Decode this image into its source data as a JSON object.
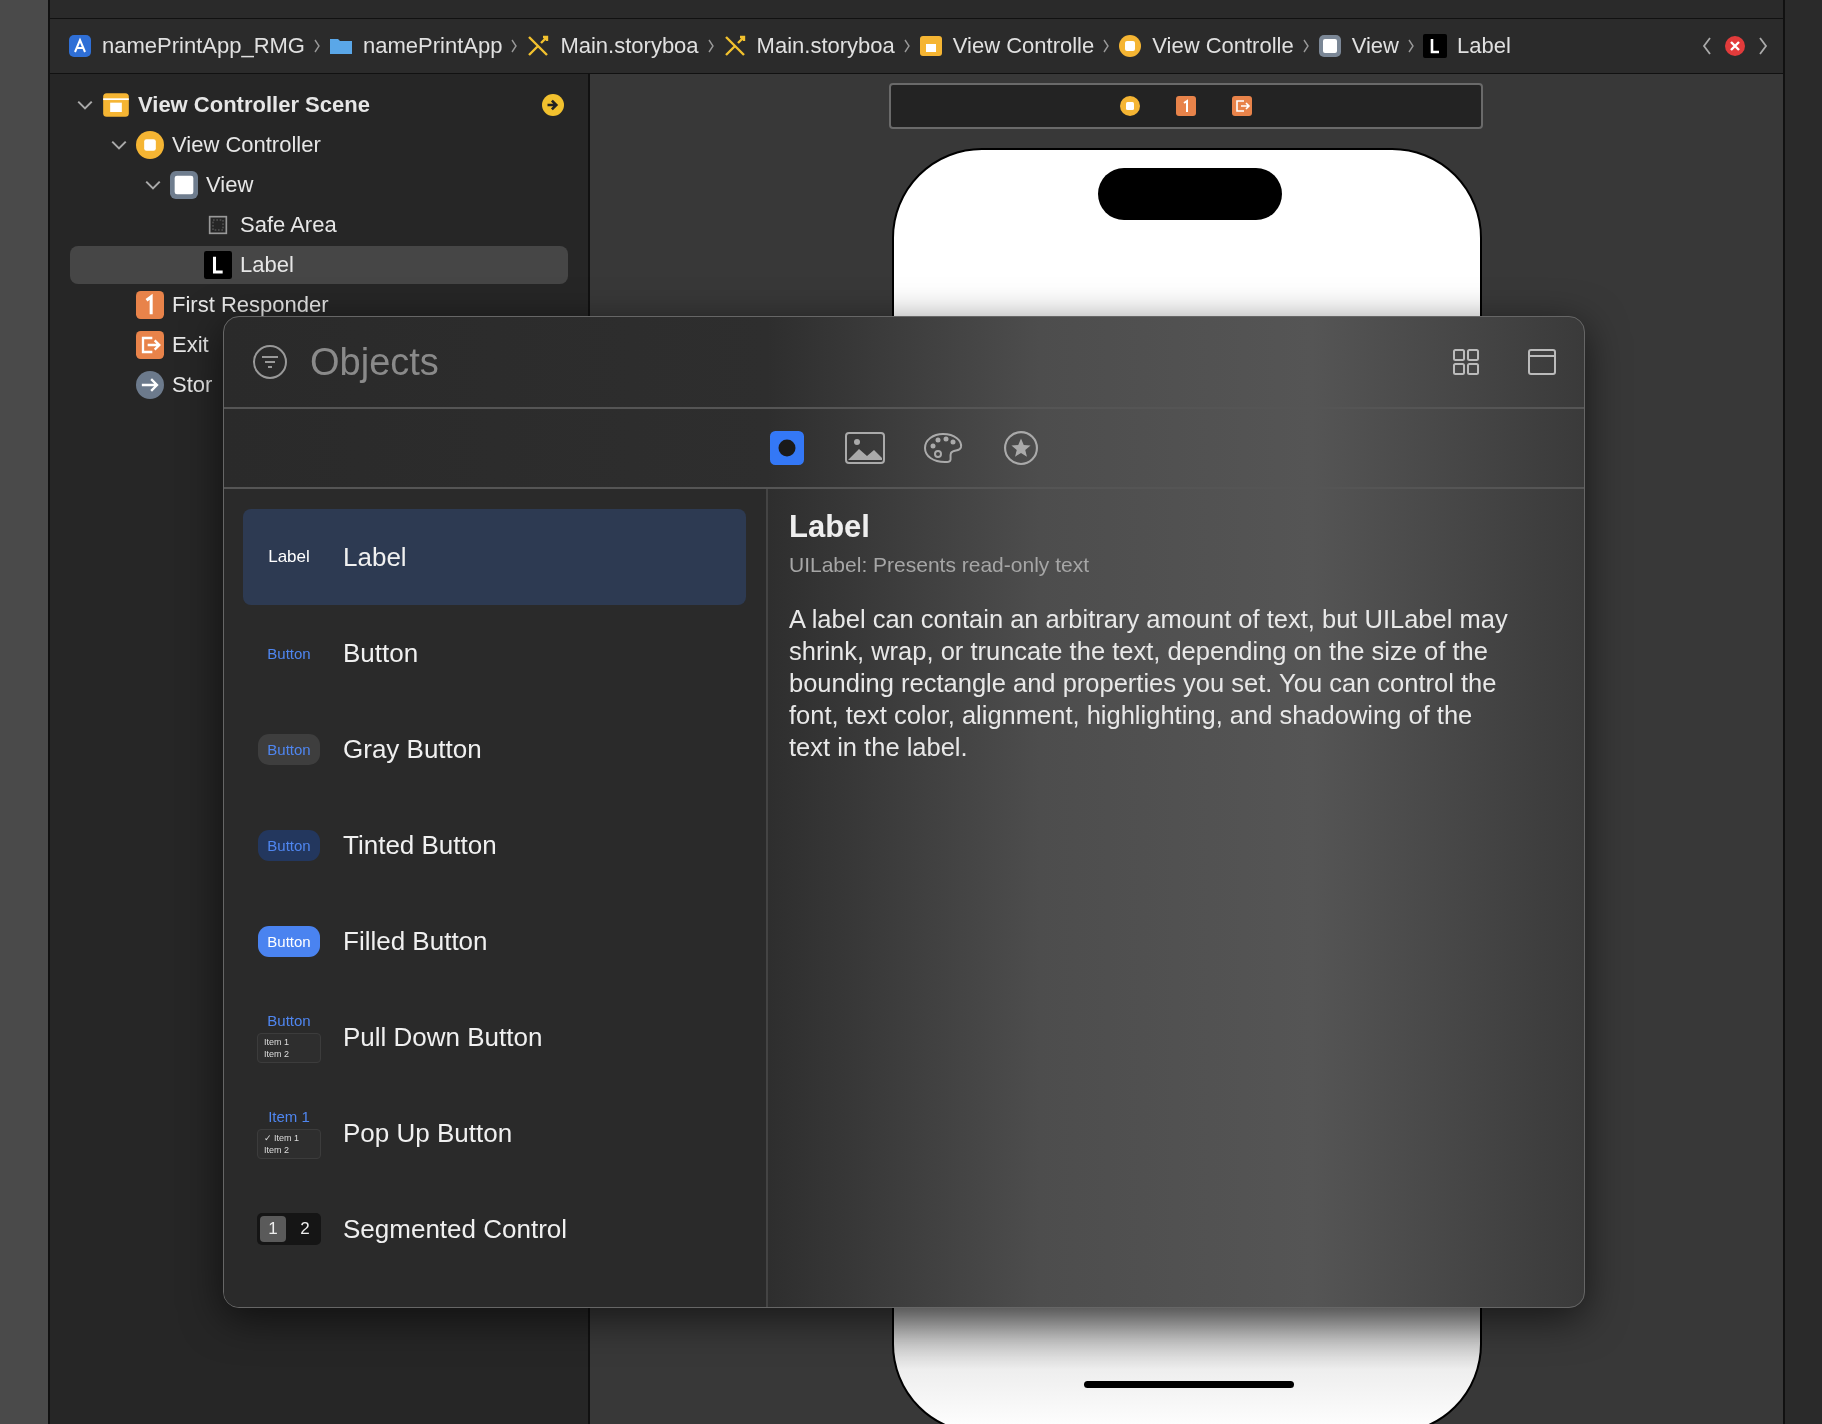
{
  "breadcrumb": [
    {
      "kind": "app",
      "label": "namePrintApp_RMG"
    },
    {
      "kind": "folder",
      "label": "namePrintApp"
    },
    {
      "kind": "storyboard",
      "label": "Main.storyboa"
    },
    {
      "kind": "storyboard",
      "label": "Main.storyboa"
    },
    {
      "kind": "scene",
      "label": "View Controlle"
    },
    {
      "kind": "controller",
      "label": "View Controlle"
    },
    {
      "kind": "view",
      "label": "View"
    },
    {
      "kind": "label",
      "label": "Label"
    }
  ],
  "navigator": {
    "items": [
      {
        "kind": "scene",
        "label": "View Controller Scene",
        "bold": true,
        "expanded": true,
        "selected": false,
        "badge": true,
        "children": [
          {
            "kind": "controller",
            "label": "View Controller",
            "expanded": true,
            "selected": false,
            "children": [
              {
                "kind": "view",
                "label": "View",
                "expanded": true,
                "selected": false,
                "children": [
                  {
                    "kind": "safe-area",
                    "label": "Safe Area",
                    "selected": false
                  },
                  {
                    "kind": "label",
                    "label": "Label",
                    "selected": true
                  }
                ]
              }
            ]
          },
          {
            "kind": "responder",
            "label": "First Responder",
            "selected": false
          },
          {
            "kind": "exit",
            "label": "Exit",
            "selected": false
          },
          {
            "kind": "entry",
            "label": "Stor",
            "selected": false
          }
        ]
      }
    ]
  },
  "library": {
    "search": {
      "placeholder": "Objects"
    },
    "tabs": [
      {
        "kind": "objects",
        "selected": true
      },
      {
        "kind": "images",
        "selected": false
      },
      {
        "kind": "colors",
        "selected": false
      },
      {
        "kind": "favorites",
        "selected": false
      }
    ],
    "items": [
      {
        "kind": "label",
        "title": "Label",
        "preview": [
          "Label"
        ],
        "selected": true
      },
      {
        "kind": "button",
        "title": "Button",
        "preview": [
          "Button"
        ],
        "selected": false
      },
      {
        "kind": "gray",
        "title": "Gray Button",
        "preview": [
          "Button"
        ],
        "selected": false
      },
      {
        "kind": "tinted",
        "title": "Tinted Button",
        "preview": [
          "Button"
        ],
        "selected": false
      },
      {
        "kind": "filled",
        "title": "Filled Button",
        "preview": [
          "Button"
        ],
        "selected": false
      },
      {
        "kind": "pulldown",
        "title": "Pull Down Button",
        "preview": [
          "Button",
          "Item 1",
          "Item 2"
        ],
        "selected": false
      },
      {
        "kind": "popup",
        "title": "Pop Up Button",
        "preview": [
          "Item 1",
          "✓ Item 1",
          "Item 2"
        ],
        "selected": false
      },
      {
        "kind": "segmented",
        "title": "Segmented Control",
        "preview": [
          "1",
          "2"
        ],
        "selected": false
      }
    ],
    "detail": {
      "title": "Label",
      "subtitle": "UILabel: Presents read-only text",
      "description": "A label can contain an arbitrary amount of text, but UILabel may shrink, wrap, or truncate the text, depending on the size of the bounding rectangle and properties you set. You can control the font, text color, alignment, highlighting, and shadowing of the text in the label."
    }
  }
}
